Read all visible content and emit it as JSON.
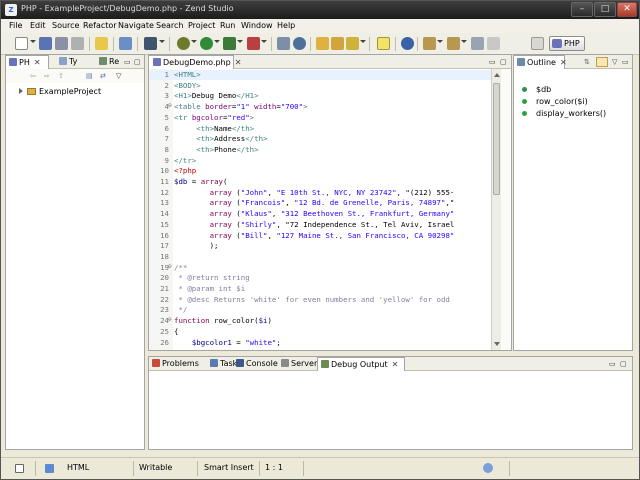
{
  "window": {
    "title": "PHP - ExampleProject/DebugDemo.php - Zend Studio"
  },
  "menu": [
    "File",
    "Edit",
    "Source",
    "Refactor",
    "Navigate",
    "Search",
    "Project",
    "Run",
    "Window",
    "Help"
  ],
  "toolbar": {
    "perspective_label": "PHP"
  },
  "explorer": {
    "tabs": [
      {
        "label": "PH"
      },
      {
        "label": "Ty"
      },
      {
        "label": "Re"
      }
    ],
    "project": "ExampleProject"
  },
  "editor": {
    "tab_label": "DebugDemo.php",
    "lines": [
      {
        "n": "1",
        "fold": "",
        "code": "<HTML>"
      },
      {
        "n": "2",
        "fold": "",
        "code": "<BODY>"
      },
      {
        "n": "3",
        "fold": "",
        "code": "<H1>Debug Demo</H1>"
      },
      {
        "n": "4",
        "fold": "⊖",
        "code": "<table border=\"1\" width=\"700\">"
      },
      {
        "n": "5",
        "fold": "",
        "code": "<tr bgcolor=\"red\">"
      },
      {
        "n": "6",
        "fold": "",
        "code": "     <th>Name</th>"
      },
      {
        "n": "7",
        "fold": "",
        "code": "     <th>Address</th>"
      },
      {
        "n": "8",
        "fold": "",
        "code": "     <th>Phone</th>"
      },
      {
        "n": "9",
        "fold": "",
        "code": "</tr>"
      },
      {
        "n": "10",
        "fold": "",
        "code": "<?php"
      },
      {
        "n": "11",
        "fold": "",
        "code": "$db = array("
      },
      {
        "n": "12",
        "fold": "",
        "code": "        array (\"John\", \"E 10th St., NYC, NY 23742\", \"(212) 555-"
      },
      {
        "n": "13",
        "fold": "",
        "code": "        array (\"Francois\", \"12 Bd. de Grenelle, Paris, 74897\",\""
      },
      {
        "n": "14",
        "fold": "",
        "code": "        array (\"Klaus\", \"312 Beethoven St., Frankfurt, Germany\""
      },
      {
        "n": "15",
        "fold": "",
        "code": "        array (\"Shirly\", \"72 Independence St., Tel Aviv, Israel"
      },
      {
        "n": "16",
        "fold": "",
        "code": "        array (\"Bill\", \"127 Maine St., San Francisco, CA 90298\""
      },
      {
        "n": "17",
        "fold": "",
        "code": "        );"
      },
      {
        "n": "18",
        "fold": "",
        "code": ""
      },
      {
        "n": "19",
        "fold": "⊖",
        "code": "/**"
      },
      {
        "n": "20",
        "fold": "",
        "code": " * @return string"
      },
      {
        "n": "21",
        "fold": "",
        "code": " * @param int $i"
      },
      {
        "n": "22",
        "fold": "",
        "code": " * @desc Returns 'white' for even numbers and 'yellow' for odd"
      },
      {
        "n": "23",
        "fold": "",
        "code": " */"
      },
      {
        "n": "24",
        "fold": "⊖",
        "code": "function row_color($i)"
      },
      {
        "n": "25",
        "fold": "",
        "code": "{"
      },
      {
        "n": "26",
        "fold": "",
        "code": "    $bgcolor1 = \"white\";"
      }
    ]
  },
  "outline": {
    "tab_label": "Outline",
    "items": [
      "$db",
      "row_color($i)",
      "display_workers()"
    ]
  },
  "bottom": {
    "tabs": [
      "Problems",
      "Tasks",
      "Console",
      "Servers",
      "Debug Output"
    ]
  },
  "status": {
    "file_type": "HTML",
    "writable": "Writable",
    "insert_mode": "Smart Insert",
    "position": "1 : 1"
  },
  "colors": {
    "keyword": "#7f0055",
    "string": "#2a00ff",
    "tag": "#3f7f7f",
    "comment": "#7f7f9f",
    "current_line": "#e8f2fe"
  }
}
